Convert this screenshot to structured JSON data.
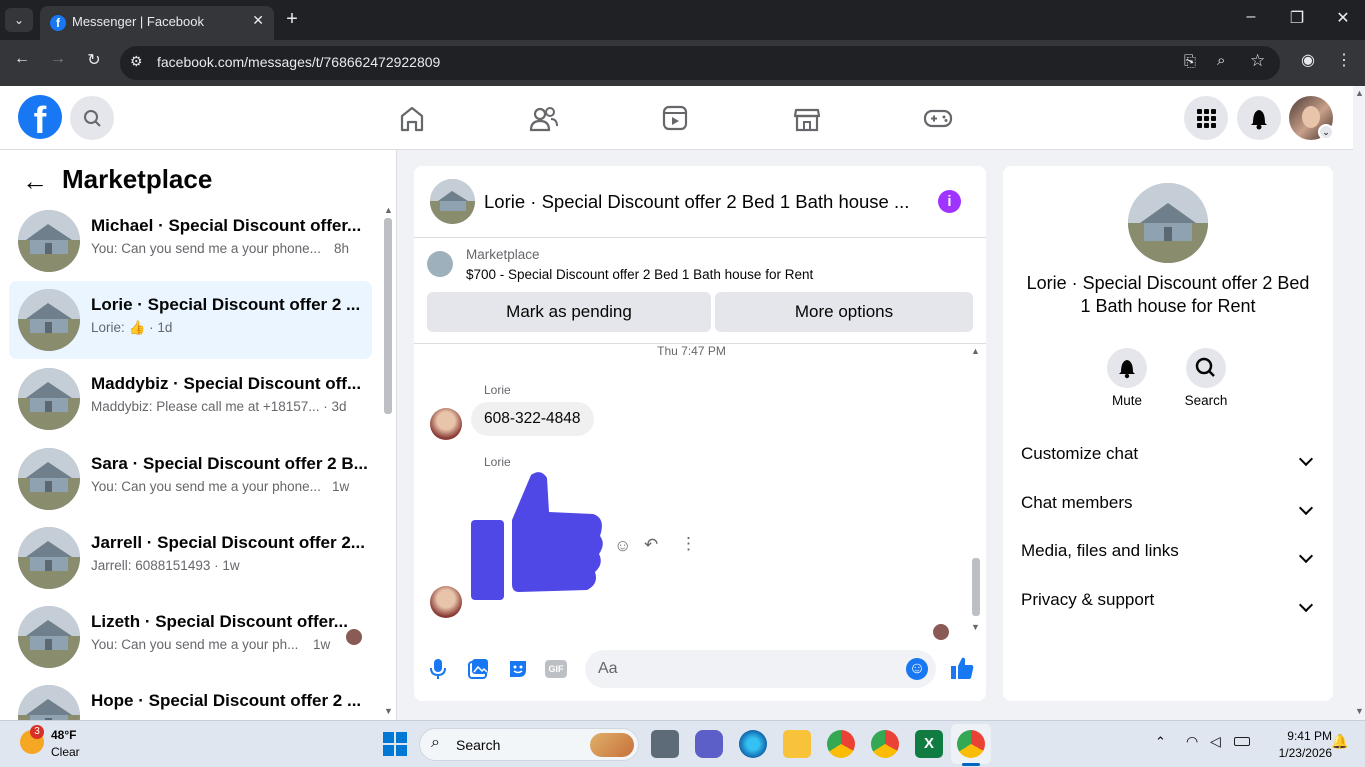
{
  "browser": {
    "tab_title": "Messenger | Facebook",
    "url": "facebook.com/messages/t/768662472922809",
    "new_tab": "+",
    "minimize": "–",
    "maximize": "❐",
    "close": "✕"
  },
  "facebook": {
    "logo": "f"
  },
  "sidebar": {
    "title": "Marketplace",
    "conversations": [
      {
        "name": "Michael · Special Discount offer...",
        "preview": "You: Can you send me a your phone...",
        "time": "8h"
      },
      {
        "name": "Lorie · Special Discount offer 2 ...",
        "preview": "Lorie:",
        "time": "· 1d"
      },
      {
        "name": "Maddybiz · Special Discount off...",
        "preview": "Maddybiz: Please call me at +18157...",
        "time": "· 3d"
      },
      {
        "name": "Sara · Special Discount offer 2 B...",
        "preview": "You: Can you send me a your phone...",
        "time": "1w"
      },
      {
        "name": "Jarrell · Special Discount offer 2...",
        "preview": "Jarrell: 6088151493",
        "time": "· 1w"
      },
      {
        "name": "Lizeth · Special Discount offer...",
        "preview": "You: Can you send me a your ph...",
        "time": "1w"
      },
      {
        "name": "Hope · Special Discount offer 2 ...",
        "preview": "",
        "time": ""
      }
    ]
  },
  "chat": {
    "header_title": "Lorie · Special Discount offer 2 Bed 1 Bath house ...",
    "listing_source": "Marketplace",
    "listing_title": "$700 - Special Discount offer 2 Bed 1 Bath house for Rent",
    "mark_pending": "Mark as pending",
    "more_options": "More options",
    "timestamp": "Thu 7:47 PM",
    "sender1": "Lorie",
    "message1": "608-322-4848",
    "sender2": "Lorie",
    "input_placeholder": "Aa"
  },
  "info": {
    "title": "Lorie · Special Discount offer 2 Bed 1 Bath house for Rent",
    "mute": "Mute",
    "search": "Search",
    "sections": [
      "Customize chat",
      "Chat members",
      "Media, files and links",
      "Privacy & support"
    ]
  },
  "taskbar": {
    "weather_temp": "48°F",
    "weather_desc": "Clear",
    "weather_badge": "3",
    "search": "Search",
    "time": "9:41 PM",
    "date": "1/23/2026"
  },
  "colors": {
    "fb_blue": "#1877f2",
    "like_blue": "#4f47e6",
    "info_purple": "#a033ff",
    "selected_bg": "#ebf5ff"
  }
}
